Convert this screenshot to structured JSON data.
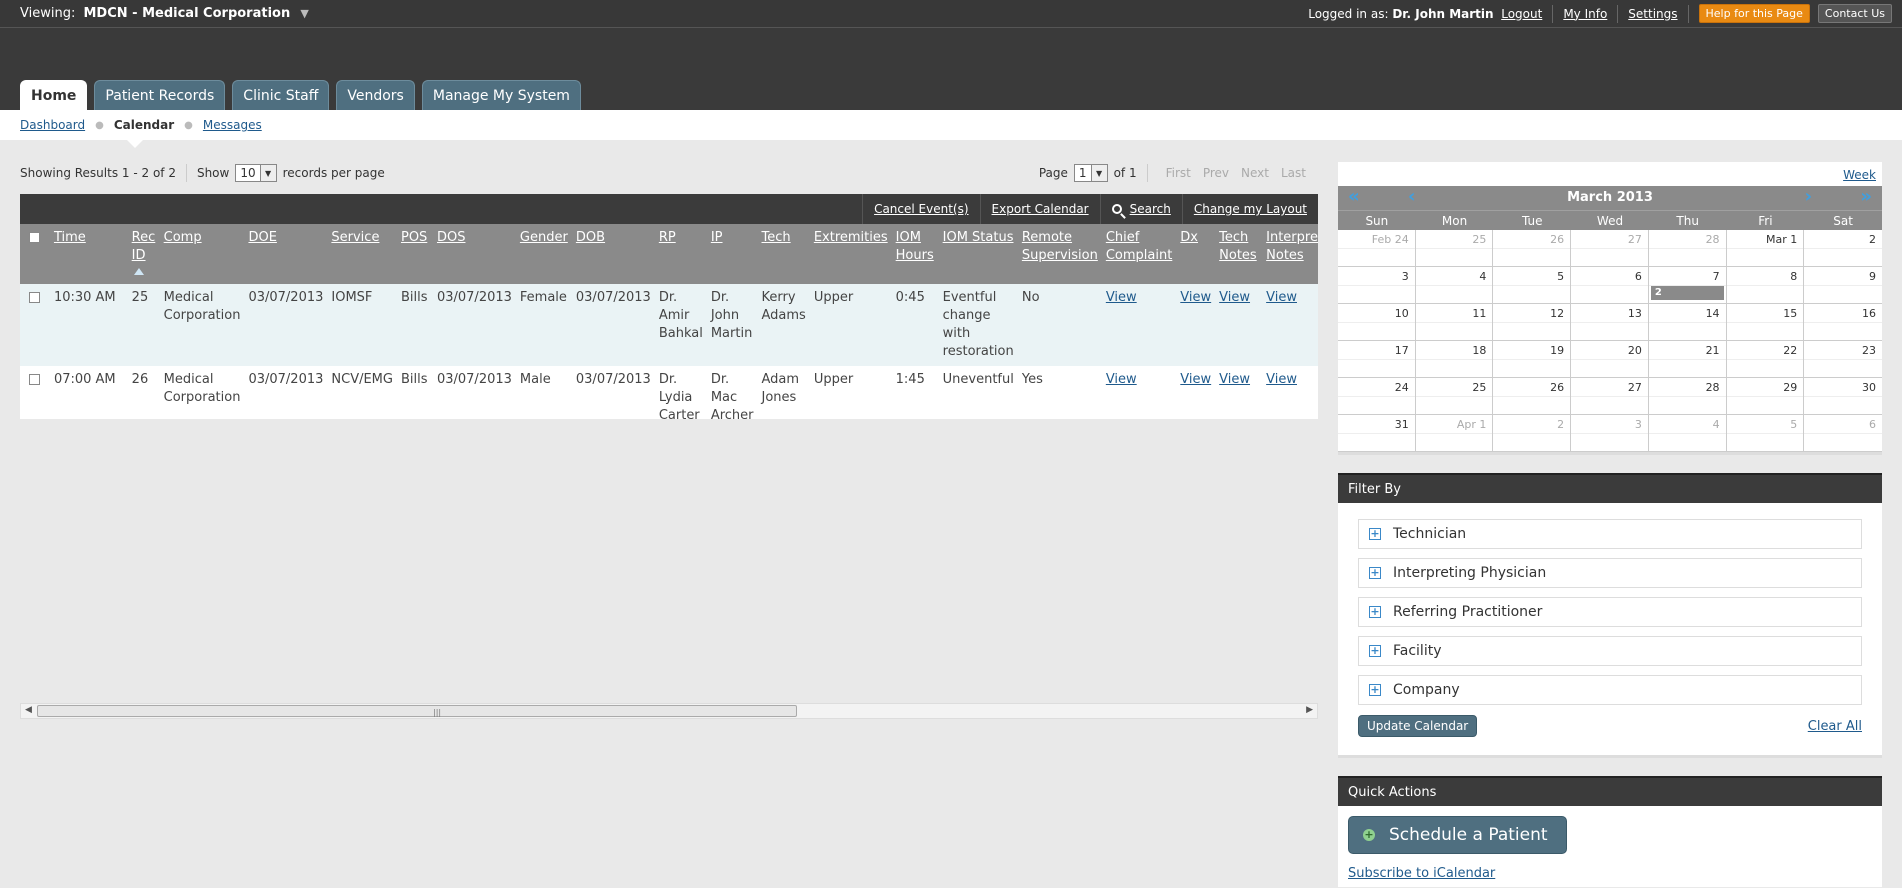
{
  "header": {
    "viewing_label": "Viewing:",
    "viewing_org": "MDCN - Medical Corporation",
    "logged_in_label": "Logged in as:",
    "user_name": "Dr. John Martin",
    "logout": "Logout",
    "my_info": "My Info",
    "settings": "Settings",
    "help": "Help for this Page",
    "contact": "Contact Us"
  },
  "tabs": [
    "Home",
    "Patient Records",
    "Clinic Staff",
    "Vendors",
    "Manage My System"
  ],
  "subnav": {
    "dashboard": "Dashboard",
    "calendar": "Calendar",
    "messages": "Messages"
  },
  "results": {
    "showing": "Showing Results 1 - 2 of 2",
    "show_label": "Show",
    "per_page_value": "10",
    "per_page_suffix": "records per page",
    "page_label": "Page",
    "page_value": "1",
    "of_label": "of 1",
    "first": "First",
    "prev": "Prev",
    "next": "Next",
    "last": "Last"
  },
  "actions": {
    "cancel": "Cancel Event(s)",
    "export": "Export Calendar",
    "search": "Search",
    "layout": "Change my Layout"
  },
  "columns": [
    "Time",
    "Rec ID",
    "Comp",
    "DOE",
    "Service",
    "POS",
    "DOS",
    "Gender",
    "DOB",
    "RP",
    "IP",
    "Tech",
    "Extremities",
    "IOM Hours",
    "IOM Status",
    "Remote Supervision",
    "Chief Complaint",
    "Dx",
    "Tech Notes",
    "Interpretation Notes"
  ],
  "rows": [
    {
      "time": "10:30 AM",
      "rec_id": "25",
      "comp": "Medical Corporation",
      "doe": "03/07/2013",
      "service": "IOMSF",
      "pos": "Bills",
      "dos": "03/07/2013",
      "gender": "Female",
      "dob": "03/07/2013",
      "rp": "Dr. Amir Bahkal",
      "ip": "Dr. John Martin",
      "tech": "Kerry Adams",
      "extremities": "Upper",
      "iom_hours": "0:45",
      "iom_status": "Eventful change with restoration",
      "remote": "No",
      "chief": "View",
      "dx": "View",
      "tech_notes": "View",
      "interp_notes": "View"
    },
    {
      "time": "07:00 AM",
      "rec_id": "26",
      "comp": "Medical Corporation",
      "doe": "03/07/2013",
      "service": "NCV/EMG",
      "pos": "Bills",
      "dos": "03/07/2013",
      "gender": "Male",
      "dob": "03/07/2013",
      "rp": "Dr. Lydia Carter",
      "ip": "Dr. Mac Archer",
      "tech": "Adam Jones",
      "extremities": "Upper",
      "iom_hours": "1:45",
      "iom_status": "Uneventful",
      "remote": "Yes",
      "chief": "View",
      "dx": "View",
      "tech_notes": "View",
      "interp_notes": "View"
    }
  ],
  "calendar": {
    "week_link": "Week",
    "month": "March 2013",
    "dow": [
      "Sun",
      "Mon",
      "Tue",
      "Wed",
      "Thu",
      "Fri",
      "Sat"
    ],
    "days": [
      {
        "n": "Feb 24",
        "m": true
      },
      {
        "n": "25",
        "m": true
      },
      {
        "n": "26",
        "m": true
      },
      {
        "n": "27",
        "m": true
      },
      {
        "n": "28",
        "m": true
      },
      {
        "n": "Mar 1"
      },
      {
        "n": "2"
      },
      {
        "n": "3"
      },
      {
        "n": "4"
      },
      {
        "n": "5"
      },
      {
        "n": "6"
      },
      {
        "n": "7",
        "evt": "2"
      },
      {
        "n": "8"
      },
      {
        "n": "9"
      },
      {
        "n": "10"
      },
      {
        "n": "11"
      },
      {
        "n": "12"
      },
      {
        "n": "13"
      },
      {
        "n": "14"
      },
      {
        "n": "15"
      },
      {
        "n": "16"
      },
      {
        "n": "17"
      },
      {
        "n": "18"
      },
      {
        "n": "19"
      },
      {
        "n": "20"
      },
      {
        "n": "21"
      },
      {
        "n": "22"
      },
      {
        "n": "23"
      },
      {
        "n": "24"
      },
      {
        "n": "25"
      },
      {
        "n": "26"
      },
      {
        "n": "27"
      },
      {
        "n": "28"
      },
      {
        "n": "29"
      },
      {
        "n": "30"
      },
      {
        "n": "31"
      },
      {
        "n": "Apr 1",
        "m": true
      },
      {
        "n": "2",
        "m": true
      },
      {
        "n": "3",
        "m": true
      },
      {
        "n": "4",
        "m": true
      },
      {
        "n": "5",
        "m": true
      },
      {
        "n": "6",
        "m": true
      }
    ]
  },
  "filter": {
    "title": "Filter By",
    "items": [
      "Technician",
      "Interpreting Physician",
      "Referring Practitioner",
      "Facility",
      "Company"
    ],
    "update": "Update Calendar",
    "clear": "Clear All"
  },
  "quick": {
    "title": "Quick Actions",
    "schedule": "Schedule a Patient",
    "subscribe": "Subscribe to iCalendar"
  }
}
